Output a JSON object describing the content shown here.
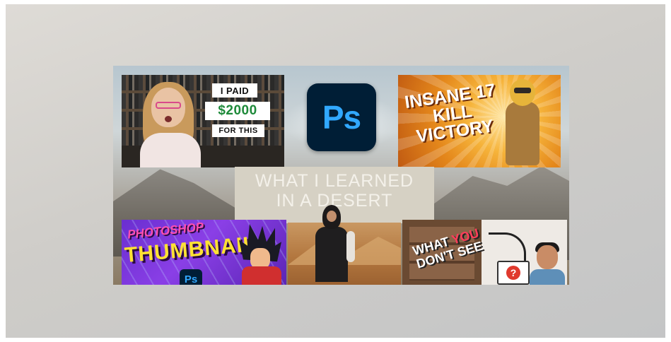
{
  "collage": {
    "tile_top_left": {
      "line1": "I PAID",
      "line2": "$2000",
      "line3": "FOR THIS"
    },
    "center_icon": {
      "label": "Ps",
      "icon": "photoshop-icon",
      "bg_color": "#001e36",
      "text_color": "#31a8ff"
    },
    "tile_top_right": {
      "title": "INSANE 17 KILL VICTORY"
    },
    "center_banner": {
      "line1": "WHAT I LEARNED",
      "line2": "IN A DESERT"
    },
    "tile_bottom_left": {
      "line1": "PHOTOSHOP",
      "line2": "THUMBNAIL",
      "badge": "Ps"
    },
    "tile_bottom_right": {
      "line1": "WHAT",
      "line1b": "YOU",
      "line2": "DON'T SEE",
      "badge": "?"
    }
  }
}
